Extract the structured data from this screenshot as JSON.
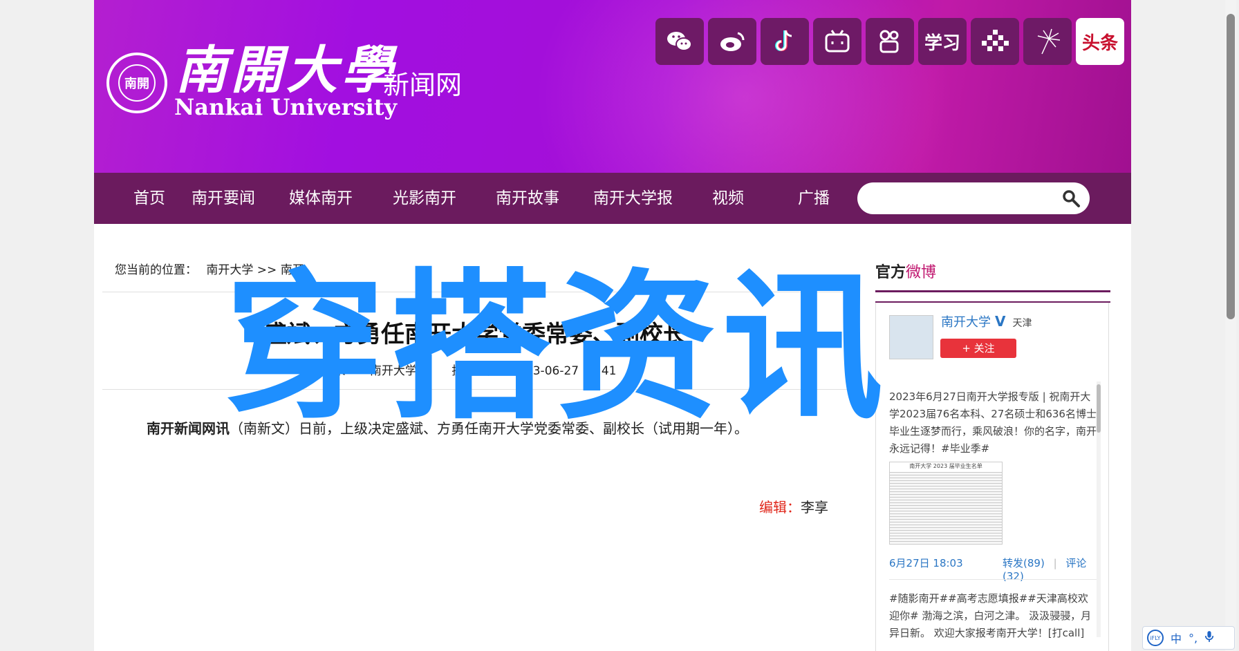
{
  "header": {
    "logo_cn": "南開大學",
    "logo_en": "Nankai University",
    "logo_sub": "新闻网",
    "seal_text": "南開",
    "social": [
      {
        "name": "wechat-icon",
        "label": ""
      },
      {
        "name": "weibo-icon",
        "label": ""
      },
      {
        "name": "douyin-icon",
        "label": ""
      },
      {
        "name": "bilibili-icon",
        "label": ""
      },
      {
        "name": "kuaishou-icon",
        "label": ""
      },
      {
        "name": "xuexi-icon",
        "label": "学习"
      },
      {
        "name": "dots-icon",
        "label": ""
      },
      {
        "name": "dandelion-icon",
        "label": ""
      },
      {
        "name": "toutiao-icon",
        "label": "头条"
      }
    ]
  },
  "nav": {
    "items": [
      "首页",
      "南开要闻",
      "媒体南开",
      "光影南开",
      "南开故事",
      "南开大学报",
      "视频",
      "广播"
    ],
    "search_placeholder": ""
  },
  "article": {
    "breadcrumb_label": "您当前的位置：",
    "breadcrumb_path": "南开大学 >> 南开",
    "title": "盛斌、方勇任南开大学党委常委、副校长",
    "meta_source_label": "来",
    "meta_source": "南开大学新",
    "meta_time_label": "投稿时间：",
    "meta_time": "2023-06-27 17:41",
    "lead_bold": "南开新闻网讯",
    "lead_rest": "（南新文）日前，上级决定盛斌、方勇任南开大学党委常委、副校长（试用期一年）。",
    "editor_label": "编辑：",
    "editor_name": "李享"
  },
  "sidebar": {
    "title_black": "官方",
    "title_pink": "微博",
    "account_name": "南开大学",
    "verified": "V",
    "city": "天津",
    "follow_label": "+ 关注",
    "post1": "2023年6月27日南开大学报专版 | 祝南开大学2023届76名本科、27名硕士和636名博士毕业生逐梦而行，乘风破浪！你的名字，南开永远记得！#毕业季#",
    "post1_image_caption": "南开大学 2023 届毕业生名单",
    "post1_time": "6月27日 18:03",
    "repost_label": "转发(89)",
    "divider": "|",
    "comment_label": "评论(32)",
    "post2": "#随影南开##高考志愿填报##天津高校欢迎你# 渤海之滨，白河之津。 汲汲骎骎，月异日新。 欢迎大家报考南开大学！[打call]"
  },
  "overlay": {
    "watermark": "穿搭资讯"
  },
  "ime": {
    "lang": "中",
    "logo": "iFLY"
  },
  "colors": {
    "nav_bg": "#6b1b5e",
    "watermark": "#1e8fff",
    "editor_label": "#e0261a",
    "link_blue": "#2a76c4"
  }
}
